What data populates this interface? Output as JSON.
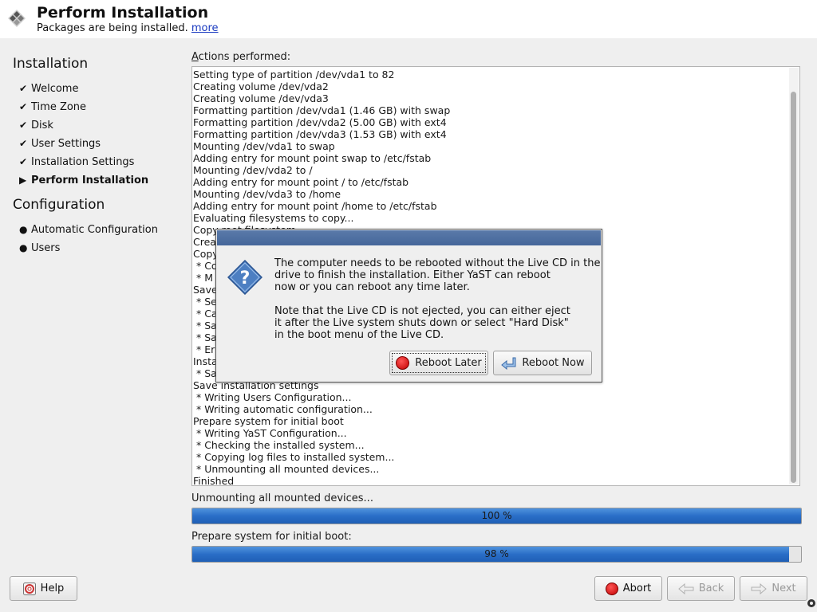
{
  "header": {
    "title": "Perform Installation",
    "subtitle": "Packages are being installed.",
    "more_link": "more"
  },
  "sidebar": {
    "installation_title": "Installation",
    "installation_steps": [
      {
        "label": "Welcome",
        "state": "done"
      },
      {
        "label": "Time Zone",
        "state": "done"
      },
      {
        "label": "Disk",
        "state": "done"
      },
      {
        "label": "User Settings",
        "state": "done"
      },
      {
        "label": "Installation Settings",
        "state": "done"
      },
      {
        "label": "Perform Installation",
        "state": "current"
      }
    ],
    "configuration_title": "Configuration",
    "configuration_steps": [
      {
        "label": "Automatic Configuration",
        "state": "pending"
      },
      {
        "label": "Users",
        "state": "pending"
      }
    ]
  },
  "main": {
    "actions_label_accel": "A",
    "actions_label_rest": "ctions performed:",
    "log": [
      "Setting type of partition /dev/vda1 to 82",
      "Creating volume /dev/vda2",
      "Creating volume /dev/vda3",
      "Formatting partition /dev/vda1 (1.46 GB) with swap",
      "Formatting partition /dev/vda2 (5.00 GB) with ext4",
      "Formatting partition /dev/vda3 (1.53 GB) with ext4",
      "Mounting /dev/vda1 to swap",
      "Adding entry for mount point swap to /etc/fstab",
      "Mounting /dev/vda2 to /",
      "Adding entry for mount point / to /etc/fstab",
      "Mounting /dev/vda3 to /home",
      "Adding entry for mount point /home to /etc/fstab",
      "Evaluating filesystems to copy...",
      "Copy root filesystem",
      "Crea",
      "Copy",
      " * Co",
      " * M",
      "Save",
      " * Se",
      " * Ca",
      " * Sa",
      " * Sa",
      " * Er",
      "Insta",
      " * Sa",
      "Save installation settings",
      " * Writing Users Configuration...",
      " * Writing automatic configuration...",
      "Prepare system for initial boot",
      " * Writing YaST Configuration...",
      " * Checking the installed system...",
      " * Copying log files to installed system...",
      " * Unmounting all mounted devices...",
      "Finished"
    ],
    "progress1": {
      "label": "Unmounting all mounted devices...",
      "percent": 100,
      "text": "100 %"
    },
    "progress2": {
      "label": "Prepare system for initial boot:",
      "percent": 98,
      "text": "98 %"
    }
  },
  "buttons": {
    "help": "Help",
    "abort": "Abort",
    "back": "Back",
    "next": "Next"
  },
  "dialog": {
    "message": "The computer needs to be rebooted without the Live CD in the\ndrive to finish the installation. Either YaST can reboot\nnow or you can reboot any time later.\n\nNote that the Live CD is not ejected, you can either eject\nit after the Live system shuts down or select \"Hard Disk\"\nin the boot menu of the Live CD.",
    "reboot_later": "Reboot Later",
    "reboot_now": "Reboot Now",
    "icon": "question-icon"
  }
}
